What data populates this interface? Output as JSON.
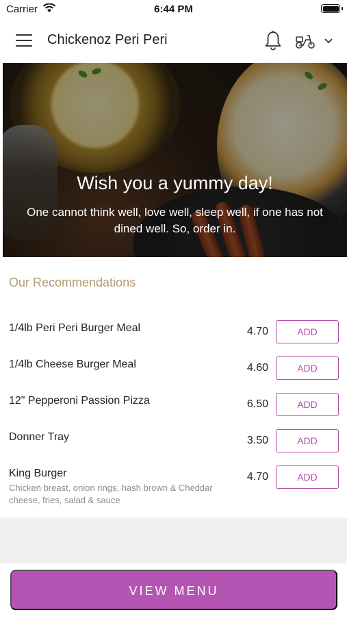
{
  "status_bar": {
    "carrier": "Carrier",
    "time": "6:44 PM"
  },
  "header": {
    "title": "Chickenoz Peri Peri",
    "icons": [
      "menu-icon",
      "bell-icon",
      "scooter-icon",
      "chevron-down-icon"
    ]
  },
  "hero": {
    "title": "Wish you a yummy day!",
    "subtitle": "One cannot think well, love well, sleep well, if one has not dined well. So, order in."
  },
  "recommendations": {
    "heading": "Our Recommendations",
    "items": [
      {
        "name": "1/4lb Peri Peri Burger Meal",
        "description": "",
        "price": "4.70",
        "add_label": "ADD"
      },
      {
        "name": "1/4lb Cheese Burger Meal",
        "description": "",
        "price": "4.60",
        "add_label": "ADD"
      },
      {
        "name": "12\" Pepperoni Passion Pizza",
        "description": "",
        "price": "6.50",
        "add_label": "ADD"
      },
      {
        "name": "Donner Tray",
        "description": "",
        "price": "3.50",
        "add_label": "ADD"
      },
      {
        "name": "King Burger",
        "description": "Chicken breast, onion rings, hash brown & Cheddar cheese, fries, salad & sauce",
        "price": "4.70",
        "add_label": "ADD"
      }
    ]
  },
  "footer": {
    "view_menu_label": "VIEW MENU"
  },
  "colors": {
    "accent": "#b455b4",
    "heading_gold": "#b29c6e",
    "add_border": "#b24fa8"
  }
}
